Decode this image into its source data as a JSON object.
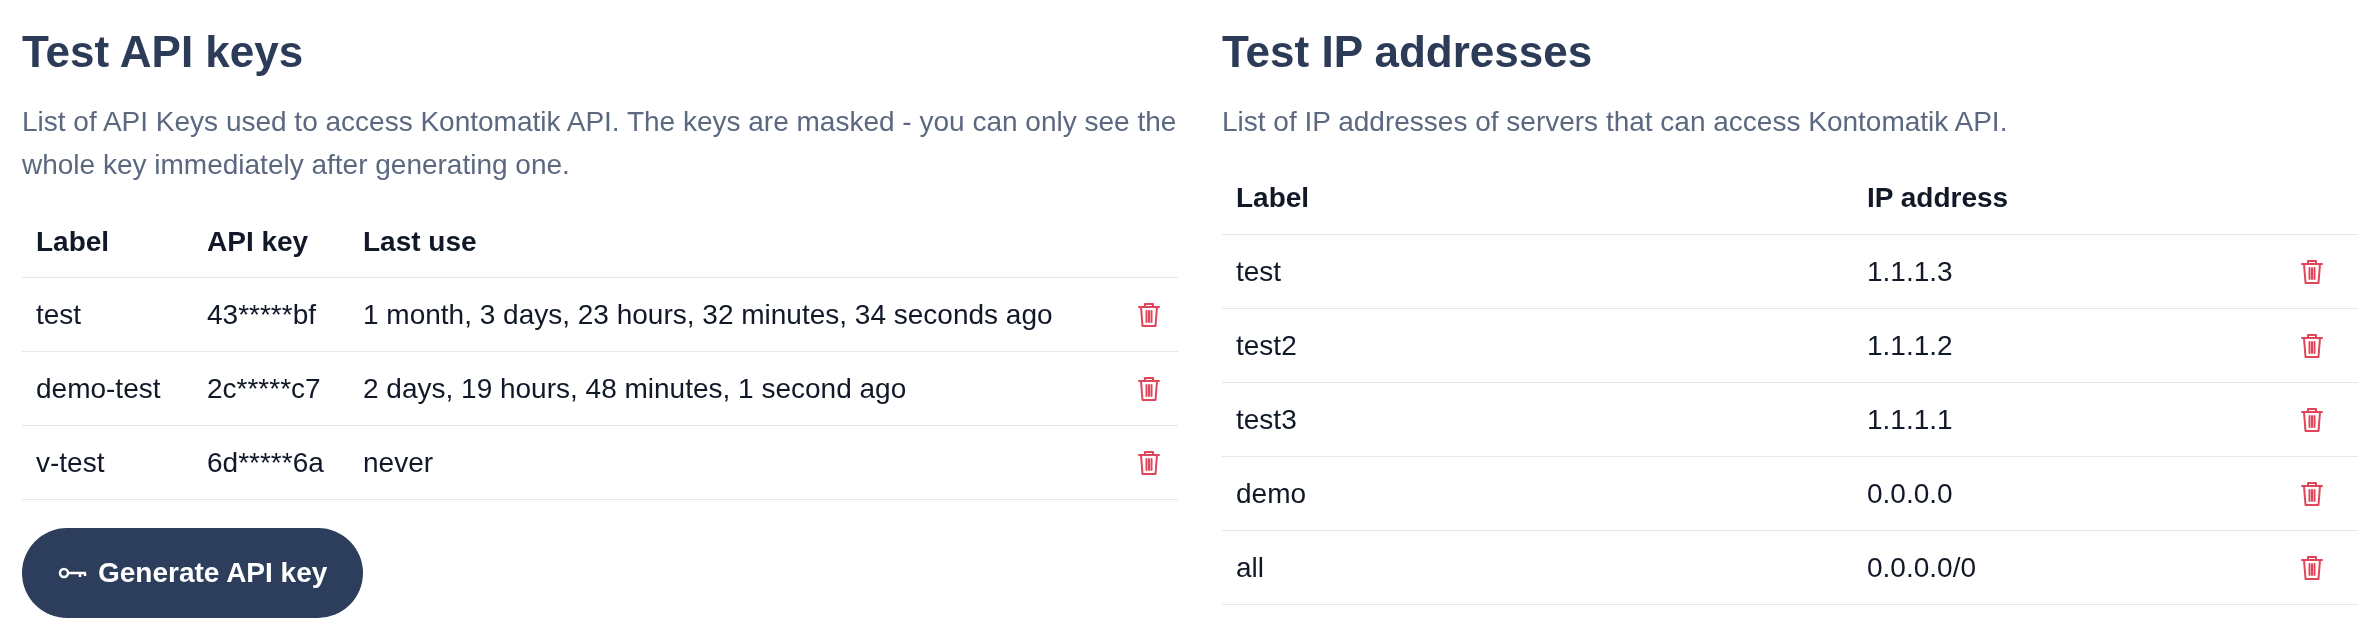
{
  "api_keys": {
    "title": "Test API keys",
    "description": "List of API Keys used to access Kontomatik API. The keys are masked - you can only see the whole key immediately after generating one.",
    "columns": [
      "Label",
      "API key",
      "Last use"
    ],
    "rows": [
      {
        "label": "test",
        "api_key": "43*****bf",
        "last_use": "1 month, 3 days, 23 hours, 32 minutes, 34 seconds ago"
      },
      {
        "label": "demo-test",
        "api_key": "2c*****c7",
        "last_use": "2 days, 19 hours, 48 minutes, 1 second ago"
      },
      {
        "label": "v-test",
        "api_key": "6d*****6a",
        "last_use": "never"
      }
    ],
    "button": "Generate API key"
  },
  "ip_addresses": {
    "title": "Test IP addresses",
    "description": "List of IP addresses of servers that can access Kontomatik API.",
    "columns": [
      "Label",
      "IP address"
    ],
    "rows": [
      {
        "label": "test",
        "ip": "1.1.1.3"
      },
      {
        "label": "test2",
        "ip": "1.1.1.2"
      },
      {
        "label": "test3",
        "ip": "1.1.1.1"
      },
      {
        "label": "demo",
        "ip": "0.0.0.0"
      },
      {
        "label": "all",
        "ip": "0.0.0.0/0"
      }
    ]
  }
}
